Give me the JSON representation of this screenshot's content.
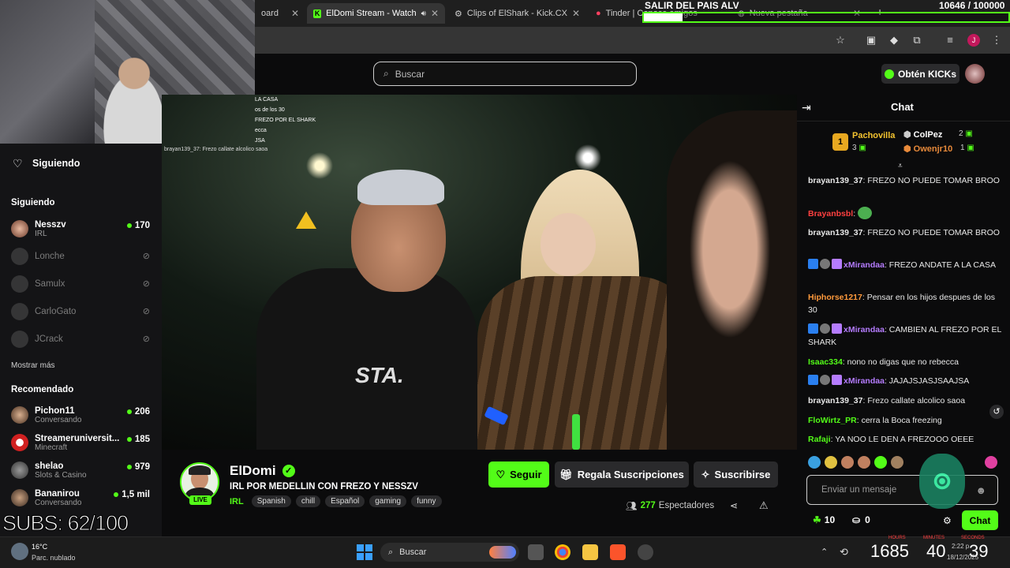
{
  "browser": {
    "tabs": [
      {
        "title": "oard",
        "active": false
      },
      {
        "title": "ElDomi Stream - Watch L",
        "active": true
      },
      {
        "title": "Clips of ElShark - Kick.CX",
        "active": false
      },
      {
        "title": "Tinder | Conoce amigos y g",
        "active": false
      },
      {
        "title": "Nueva pestaña",
        "active": false
      }
    ]
  },
  "goal": {
    "label": "SALIR DEL PAIS ALV",
    "count": "10646 / 100000",
    "progress": 0.106
  },
  "kick_header": {
    "search_placeholder": "Buscar",
    "get_kicks_label": "Obtén KICKs"
  },
  "sidebar": {
    "following_header": "Siguiendo",
    "following_section": "Siguiendo",
    "following": [
      {
        "name": "Nesszv",
        "sub": "IRL",
        "viewers": "170",
        "live": true
      },
      {
        "name": "Lonche",
        "sub": "",
        "viewers": "",
        "live": false
      },
      {
        "name": "Samulx",
        "sub": "",
        "viewers": "",
        "live": false
      },
      {
        "name": "CarloGato",
        "sub": "",
        "viewers": "",
        "live": false
      },
      {
        "name": "JCrack",
        "sub": "",
        "viewers": "",
        "live": false
      }
    ],
    "show_more": "Mostrar más",
    "recommended_section": "Recomendado",
    "recommended": [
      {
        "name": "Pichon11",
        "sub": "Conversando",
        "viewers": "206"
      },
      {
        "name": "Streameruniversit...",
        "sub": "Minecraft",
        "viewers": "185"
      },
      {
        "name": "shelao",
        "sub": "Slots & Casino",
        "viewers": "979"
      },
      {
        "name": "Bananirou",
        "sub": "Conversando",
        "viewers": "1,5 mil"
      }
    ]
  },
  "overlay": {
    "subs_text": "SUBS: 62/100",
    "stream_text_lines": [
      "LA CASA",
      "os de los 30",
      "FREZO POR EL SHARK",
      "ecca",
      "JSA"
    ],
    "webcam_chat_line": "brayan139_37: Frezo callate alcolico saoa"
  },
  "channel": {
    "name": "ElDomi",
    "live_label": "LIVE",
    "title": "IRL POR MEDELLIN CON FREZO Y NESSZV",
    "category": "IRL",
    "tags": [
      "Spanish",
      "chill",
      "Español",
      "gaming",
      "funny"
    ],
    "follow_label": "Seguir",
    "gift_label": "Regala Suscripciones",
    "subscribe_label": "Suscribirse",
    "viewers": "277",
    "viewers_label": "Espectadores"
  },
  "chat": {
    "header": "Chat",
    "leaderboard": [
      {
        "rank": "1",
        "name": "Pachovilla",
        "value": "3"
      },
      {
        "rank": "",
        "name": "ColPez",
        "value": "2"
      },
      {
        "rank": "",
        "name": "Owenjr10",
        "value": "1"
      }
    ],
    "messages": [
      {
        "user": "brayan139_37",
        "color": "#e8e8e8",
        "text": "FREZO NO PUEDE TOMAR BROO"
      },
      {
        "user": "Brayanbsbl",
        "color": "#ff4040",
        "text": ""
      },
      {
        "user": "brayan139_37",
        "color": "#e8e8e8",
        "text": "FREZO NO PUEDE TOMAR BROO"
      },
      {
        "user": "xMirandaa",
        "color": "#b57cff",
        "text": "FREZO ANDATE A LA CASA"
      },
      {
        "user": "Hiphorse1217",
        "color": "#ff9a3c",
        "text": "Pensar en los hijos despues de los 30"
      },
      {
        "user": "xMirandaa",
        "color": "#b57cff",
        "text": "CAMBIEN AL FREZO POR EL SHARK"
      },
      {
        "user": "Isaac334",
        "color": "#53fc18",
        "text": "nono no digas que no rebecca"
      },
      {
        "user": "xMirandaa",
        "color": "#b57cff",
        "text": "JAJAJSJASJSAAJSA"
      },
      {
        "user": "brayan139_37",
        "color": "#e8e8e8",
        "text": "Frezo callate alcolico saoa"
      },
      {
        "user": "FloWirtz_PR",
        "color": "#53fc18",
        "text": "cerra la Boca freezing"
      },
      {
        "user": "Rafaji",
        "color": "#53fc18",
        "text": "YA NOO LE DEN A FREZOOO OEEE"
      }
    ],
    "input_placeholder": "Enviar un mensaje",
    "points": "10",
    "gifts": "0",
    "send_label": "Chat"
  },
  "taskbar": {
    "weather_temp": "16°C",
    "weather_desc": "Parc. nublado",
    "search_label": "Buscar",
    "clock_overlay": "1685",
    "clock_minutes": "40",
    "clock_seconds": "39",
    "clock_hours_label": "HOURS",
    "clock_minutes_label": "MINUTES",
    "clock_seconds_label": "SECONDS",
    "date": "18/12/2025",
    "time": "2:22 p"
  },
  "colors": {
    "accent": "#53fc18",
    "bg": "#0b0b0c",
    "sidebar": "#141416"
  }
}
